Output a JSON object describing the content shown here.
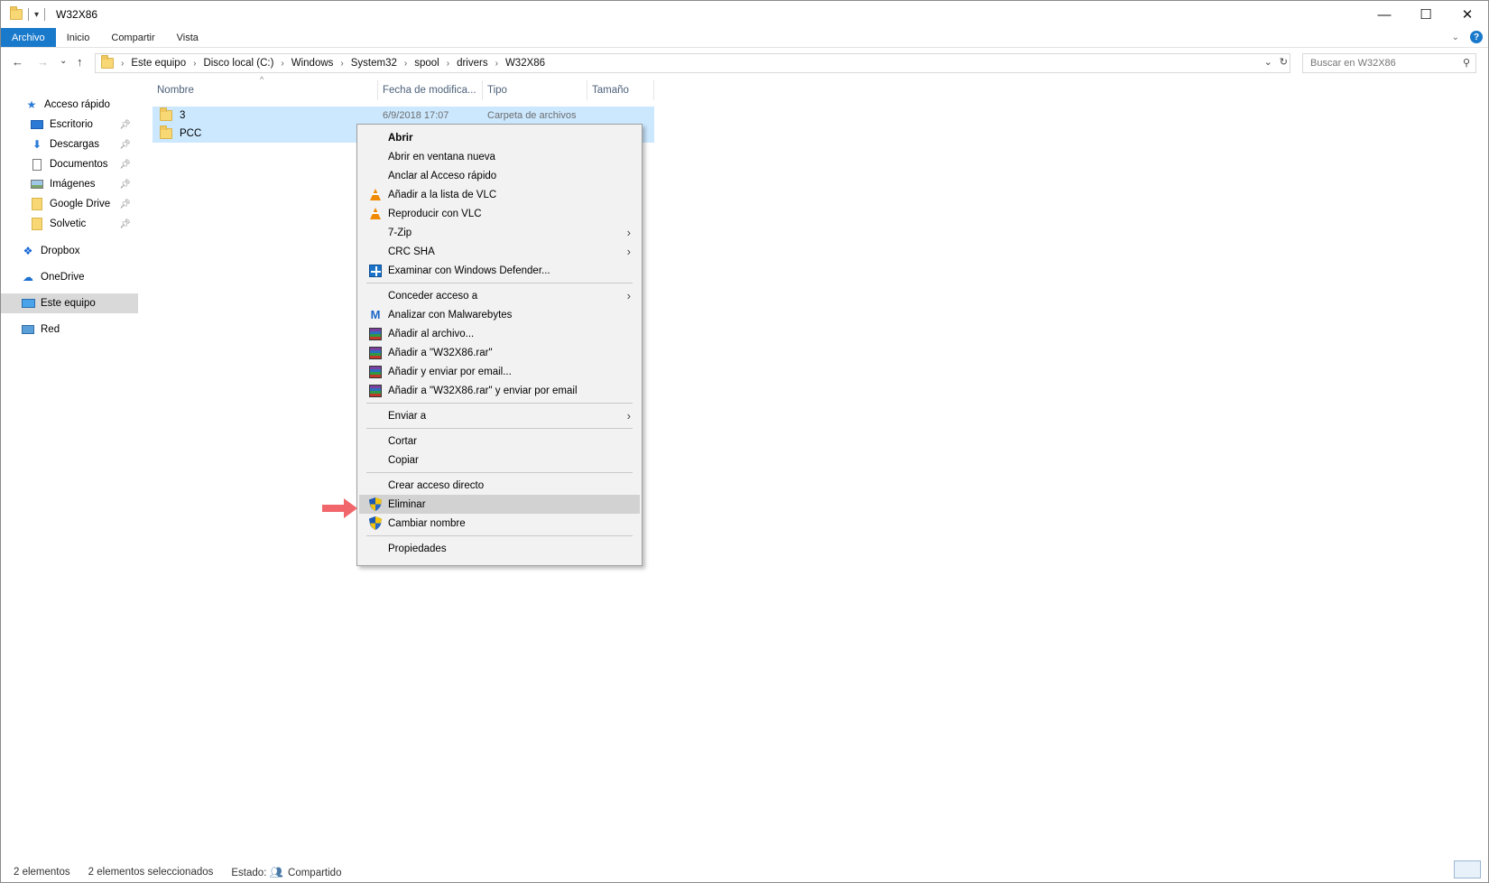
{
  "window": {
    "title": "W32X86",
    "controls": {
      "minimize": "—",
      "maximize": "☐",
      "close": "✕"
    }
  },
  "ribbon": {
    "tabs": [
      "Archivo",
      "Inicio",
      "Compartir",
      "Vista"
    ],
    "active_tab": "Archivo",
    "help": "?"
  },
  "navigation": {
    "back": "←",
    "forward": "→",
    "recent": "⌄",
    "up": "↑",
    "breadcrumb": [
      "Este equipo",
      "Disco local (C:)",
      "Windows",
      "System32",
      "spool",
      "drivers",
      "W32X86"
    ],
    "search_placeholder": "Buscar en W32X86"
  },
  "sidebar": {
    "quick_access": "Acceso rápido",
    "pinned": [
      "Escritorio",
      "Descargas",
      "Documentos",
      "Imágenes",
      "Google Drive",
      "Solvetic"
    ],
    "locations": [
      "Dropbox",
      "OneDrive",
      "Este equipo",
      "Red"
    ],
    "selected": "Este equipo"
  },
  "file_list": {
    "columns": [
      "Nombre",
      "Fecha de modifica...",
      "Tipo",
      "Tamaño"
    ],
    "rows": [
      {
        "name": "3",
        "date": "6/9/2018 17:07",
        "type": "Carpeta de archivos",
        "size": ""
      },
      {
        "name": "PCC",
        "date": "",
        "type": "",
        "size": ""
      }
    ]
  },
  "context_menu": {
    "items": [
      {
        "label": "Abrir",
        "icon": "none",
        "bold": true
      },
      {
        "label": "Abrir en ventana nueva",
        "icon": "none"
      },
      {
        "label": "Anclar al Acceso rápido",
        "icon": "none"
      },
      {
        "label": "Añadir a la lista de VLC",
        "icon": "vlc-icon"
      },
      {
        "label": "Reproducir con VLC",
        "icon": "vlc-icon"
      },
      {
        "label": "7-Zip",
        "icon": "none",
        "submenu": true
      },
      {
        "label": "CRC SHA",
        "icon": "none",
        "submenu": true
      },
      {
        "label": "Examinar con Windows Defender...",
        "icon": "defender-icon"
      },
      {
        "label": "Conceder acceso a",
        "icon": "none",
        "submenu": true
      },
      {
        "label": "Analizar con Malwarebytes",
        "icon": "malwarebytes-icon"
      },
      {
        "label": "Añadir al archivo...",
        "icon": "winrar-icon"
      },
      {
        "label": "Añadir a \"W32X86.rar\"",
        "icon": "winrar-icon"
      },
      {
        "label": "Añadir y enviar por email...",
        "icon": "winrar-icon"
      },
      {
        "label": "Añadir a \"W32X86.rar\" y enviar por email",
        "icon": "winrar-icon"
      },
      {
        "label": "Enviar a",
        "icon": "none",
        "submenu": true
      },
      {
        "label": "Cortar",
        "icon": "none"
      },
      {
        "label": "Copiar",
        "icon": "none"
      },
      {
        "label": "Crear acceso directo",
        "icon": "none"
      },
      {
        "label": "Eliminar",
        "icon": "uac-shield-icon",
        "highlighted": true
      },
      {
        "label": "Cambiar nombre",
        "icon": "uac-shield-icon"
      },
      {
        "label": "Propiedades",
        "icon": "none"
      }
    ]
  },
  "status_bar": {
    "count": "2 elementos",
    "selected": "2 elementos seleccionados",
    "state_label": "Estado:",
    "state_value": "Compartido"
  },
  "colors": {
    "accent": "#1979ca",
    "selection": "#cce8ff",
    "menu_bg": "#f2f2f2",
    "menu_hover": "#d2d2d2",
    "arrow": "#f0666b"
  }
}
